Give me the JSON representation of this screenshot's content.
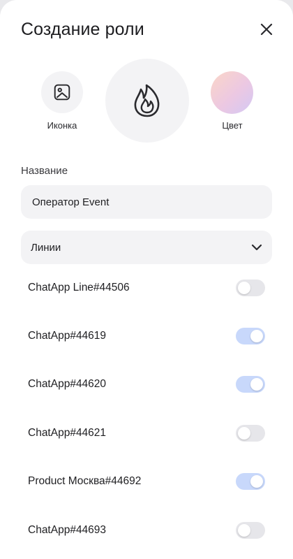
{
  "header": {
    "title": "Создание роли"
  },
  "picker": {
    "icon_label": "Иконка",
    "color_label": "Цвет",
    "preview_icon": "flame-icon",
    "color_gradient": [
      "#fbd6c7",
      "#ecc8e2",
      "#d3c9f4"
    ]
  },
  "name_field": {
    "label": "Название",
    "value": "Оператор Event"
  },
  "lines": {
    "label": "Линии",
    "items": [
      {
        "label": "ChatApp Line#44506",
        "enabled": false
      },
      {
        "label": "ChatApp#44619",
        "enabled": true
      },
      {
        "label": "ChatApp#44620",
        "enabled": true
      },
      {
        "label": "ChatApp#44621",
        "enabled": false
      },
      {
        "label": "Product Москва#44692",
        "enabled": true
      },
      {
        "label": "ChatApp#44693",
        "enabled": false
      }
    ]
  },
  "colors": {
    "toggle_on": "#c8d8fb",
    "toggle_off": "#e6e6ea",
    "field_bg": "#f3f3f5"
  }
}
